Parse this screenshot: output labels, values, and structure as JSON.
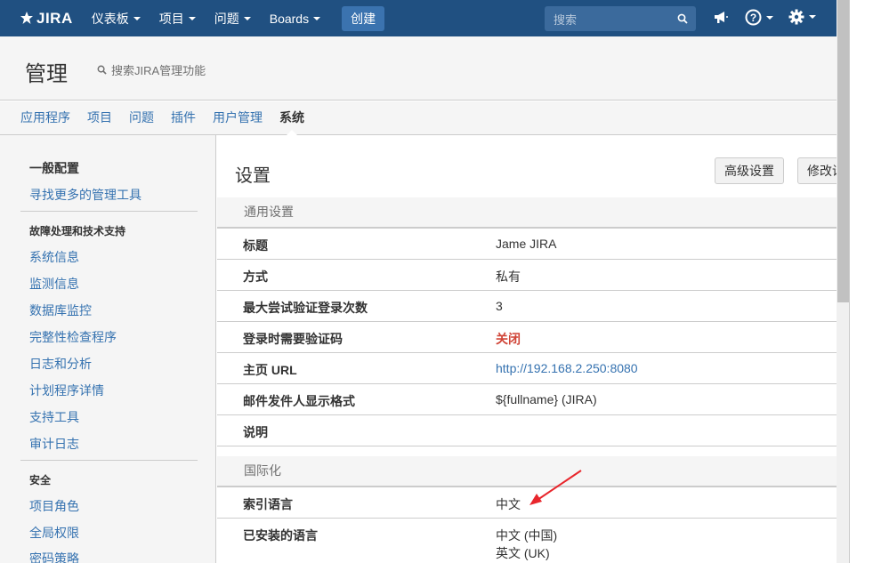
{
  "topnav": {
    "logo_text": "JIRA",
    "items": [
      "仪表板",
      "项目",
      "问题",
      "Boards"
    ],
    "create_label": "创建",
    "search_placeholder": "搜索"
  },
  "admin": {
    "title": "管理",
    "search_label": "搜索JIRA管理功能",
    "tabs": [
      "应用程序",
      "项目",
      "问题",
      "插件",
      "用户管理",
      "系统"
    ],
    "active_tab": "系统"
  },
  "sidebar": {
    "active": "一般配置",
    "link_more": "寻找更多的管理工具",
    "group1_title": "故障处理和技术支持",
    "group1_items": [
      "系统信息",
      "监测信息",
      "数据库监控",
      "完整性检查程序",
      "日志和分析",
      "计划程序详情",
      "支持工具",
      "审计日志"
    ],
    "group2_title": "安全",
    "group2_items": [
      "项目角色",
      "全局权限",
      "密码策略"
    ]
  },
  "main": {
    "title": "设置",
    "advanced_button": "高级设置",
    "edit_button": "修改设置",
    "general_section": "通用设置",
    "general_rows": [
      {
        "key": "标题",
        "value": "Jame JIRA"
      },
      {
        "key": "方式",
        "value": "私有"
      },
      {
        "key": "最大尝试验证登录次数",
        "value": "3"
      },
      {
        "key": "登录时需要验证码",
        "value": "关闭"
      },
      {
        "key": "主页 URL",
        "value": "http://192.168.2.250:8080"
      },
      {
        "key": "邮件发件人显示格式",
        "value": "${fullname} (JIRA)"
      },
      {
        "key": "说明",
        "value": ""
      }
    ],
    "i18n_section": "国际化",
    "i18n_rows": [
      {
        "key": "索引语言",
        "value": "中文"
      },
      {
        "key": "已安装的语言",
        "values": [
          "中文 (中国)",
          "英文 (UK)"
        ]
      }
    ]
  },
  "colors": {
    "topbar": "#205081",
    "link": "#3572b0",
    "off_red": "#d04437",
    "annotation_arrow": "#e8262c"
  }
}
